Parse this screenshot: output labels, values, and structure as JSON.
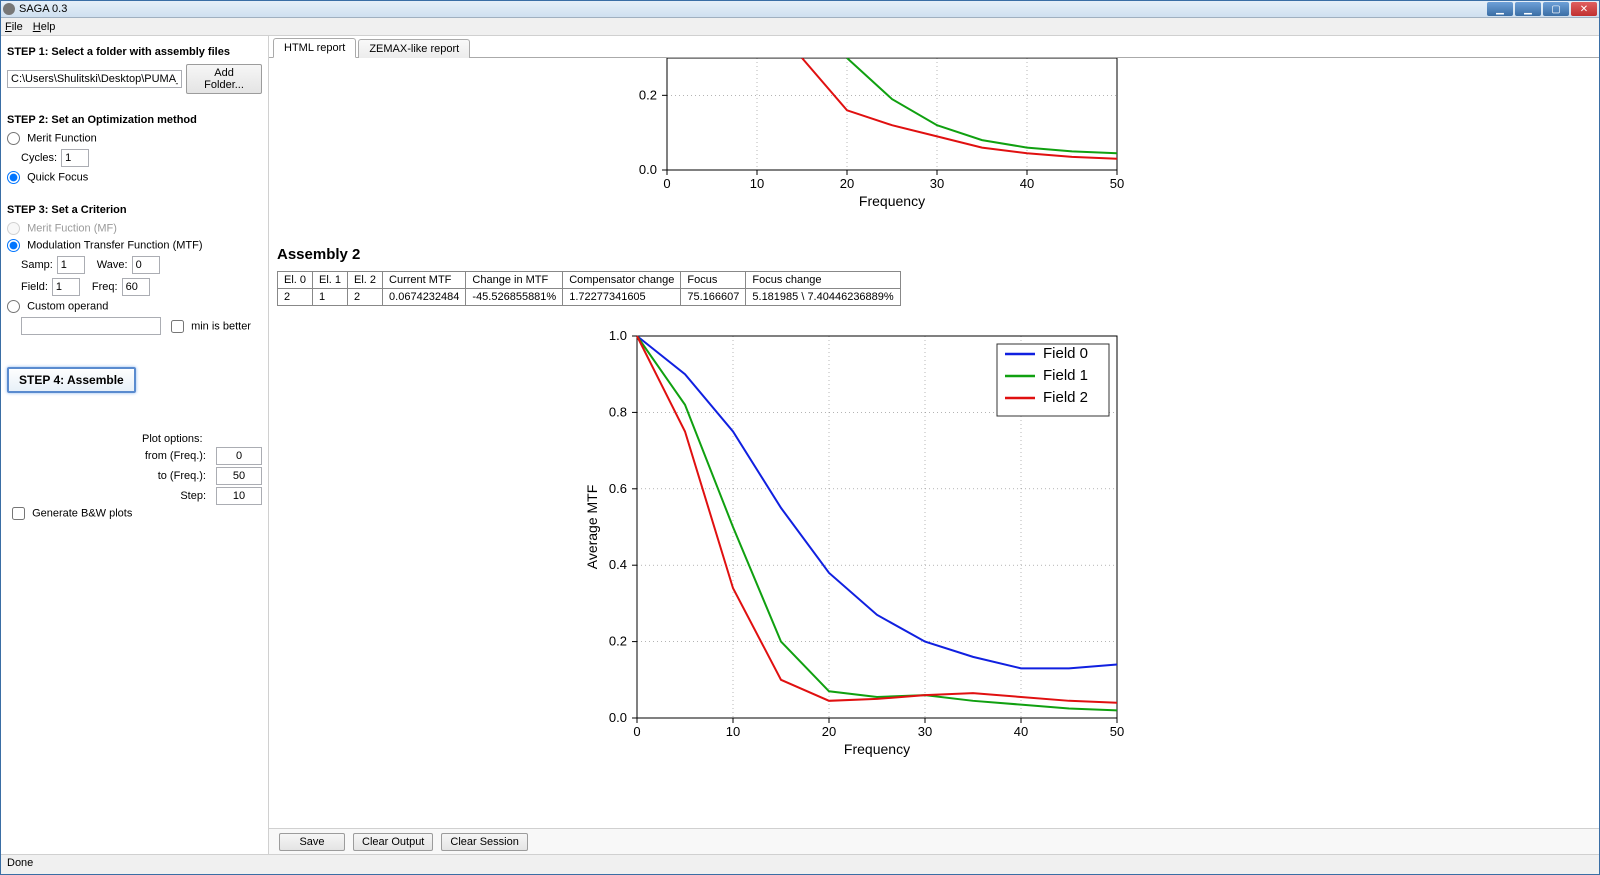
{
  "window": {
    "title": "SAGA 0.3"
  },
  "menu": {
    "file": "File",
    "help": "Help"
  },
  "sidebar": {
    "step1": {
      "title": "STEP 1: Select a folder with assembly files",
      "path": "C:\\Users\\Shulitski\\Desktop\\PUMA_data",
      "add_btn": "Add Folder..."
    },
    "step2": {
      "title": "STEP 2: Set an Optimization method",
      "merit_label": "Merit Function",
      "cycles_label": "Cycles:",
      "cycles_value": "1",
      "quick_label": "Quick Focus"
    },
    "step3": {
      "title": "STEP 3: Set a Criterion",
      "mf_label": "Merit Fuction (MF)",
      "mtf_label": "Modulation Transfer Function (MTF)",
      "samp_label": "Samp:",
      "samp_value": "1",
      "wave_label": "Wave:",
      "wave_value": "0",
      "field_label": "Field:",
      "field_value": "1",
      "freq_label": "Freq:",
      "freq_value": "60",
      "custom_label": "Custom operand",
      "custom_value": "",
      "min_label": "min is better"
    },
    "step4": {
      "btn": "STEP 4: Assemble"
    },
    "plot": {
      "title": "Plot options:",
      "from_label": "from (Freq.):",
      "from_value": "0",
      "to_label": "to (Freq.):",
      "to_value": "50",
      "step_label": "Step:",
      "step_value": "10",
      "bw_label": "Generate B&W plots"
    }
  },
  "tabs": {
    "html": "HTML report",
    "zemax": "ZEMAX-like report"
  },
  "report": {
    "assembly_title": "Assembly 2",
    "table": {
      "headers": [
        "El. 0",
        "El. 1",
        "El. 2",
        "Current MTF",
        "Change in MTF",
        "Compensator change",
        "Focus",
        "Focus change"
      ],
      "row": [
        "2",
        "1",
        "2",
        "0.0674232484",
        "-45.526855881%",
        "1.72277341605",
        "75.166607",
        "5.181985 \\ 7.40446236889%"
      ]
    }
  },
  "buttons": {
    "save": "Save",
    "clear_output": "Clear Output",
    "clear_session": "Clear Session"
  },
  "status": "Done",
  "chart_data": [
    {
      "type": "line",
      "partial": true,
      "xlabel": "Frequency",
      "ylabel": "",
      "xlim": [
        0,
        50
      ],
      "ylim": [
        0.0,
        0.3
      ],
      "xticks": [
        0,
        10,
        20,
        30,
        40,
        50
      ],
      "yticks": [
        0.0,
        0.2
      ],
      "x": [
        0,
        5,
        10,
        15,
        20,
        25,
        30,
        35,
        40,
        45,
        50
      ],
      "series": [
        {
          "name": "Field 0",
          "color": "#1020e0",
          "values": [
            null,
            null,
            null,
            null,
            null,
            null,
            null,
            null,
            null,
            null,
            null
          ]
        },
        {
          "name": "Field 1",
          "color": "#10a010",
          "values": [
            null,
            null,
            null,
            null,
            0.3,
            0.19,
            0.12,
            0.08,
            0.06,
            0.05,
            0.045
          ]
        },
        {
          "name": "Field 2",
          "color": "#e01010",
          "values": [
            null,
            null,
            null,
            0.3,
            0.16,
            0.12,
            0.09,
            0.06,
            0.045,
            0.035,
            0.03
          ]
        }
      ]
    },
    {
      "type": "line",
      "title": "",
      "xlabel": "Frequency",
      "ylabel": "Average MTF",
      "xlim": [
        0,
        50
      ],
      "ylim": [
        0.0,
        1.0
      ],
      "xticks": [
        0,
        10,
        20,
        30,
        40,
        50
      ],
      "yticks": [
        0.0,
        0.2,
        0.4,
        0.6,
        0.8,
        1.0
      ],
      "x": [
        0,
        5,
        10,
        15,
        20,
        25,
        30,
        35,
        40,
        45,
        50
      ],
      "legend": [
        "Field 0",
        "Field 1",
        "Field 2"
      ],
      "series": [
        {
          "name": "Field 0",
          "color": "#1020e0",
          "values": [
            1.0,
            0.9,
            0.75,
            0.55,
            0.38,
            0.27,
            0.2,
            0.16,
            0.13,
            0.13,
            0.14
          ]
        },
        {
          "name": "Field 1",
          "color": "#10a010",
          "values": [
            1.0,
            0.82,
            0.5,
            0.2,
            0.07,
            0.055,
            0.06,
            0.045,
            0.035,
            0.025,
            0.02
          ]
        },
        {
          "name": "Field 2",
          "color": "#e01010",
          "values": [
            1.0,
            0.75,
            0.34,
            0.1,
            0.045,
            0.05,
            0.06,
            0.065,
            0.055,
            0.045,
            0.04
          ]
        }
      ]
    }
  ]
}
